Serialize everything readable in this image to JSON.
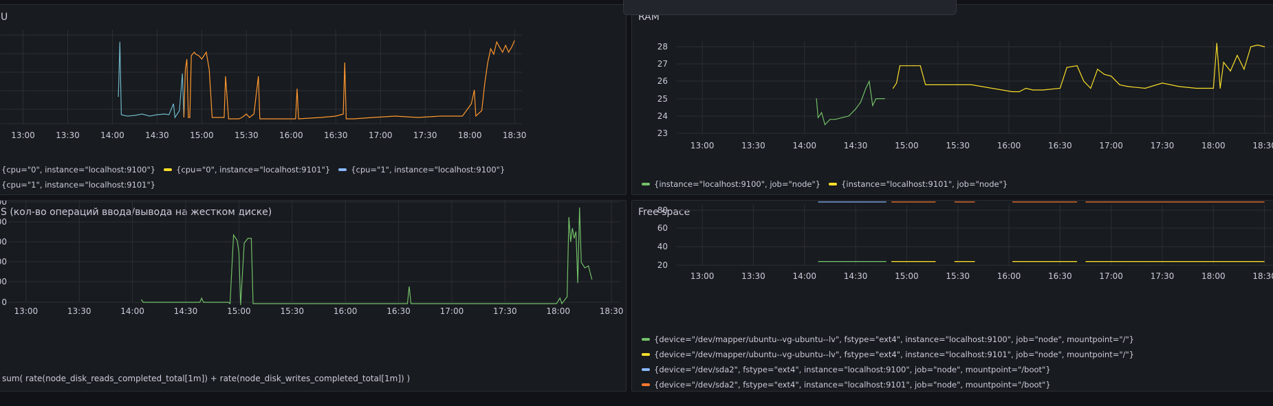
{
  "panels": {
    "cpu": {
      "title": "U",
      "x_ticks": [
        "13:00",
        "13:30",
        "14:00",
        "14:30",
        "15:00",
        "15:30",
        "16:00",
        "16:30",
        "17:00",
        "17:30",
        "18:00",
        "18:30"
      ],
      "legend": [
        [
          {
            "label": "{cpu=\"0\", instance=\"localhost:9100\"}",
            "color": ""
          },
          {
            "label": "{cpu=\"0\", instance=\"localhost:9101\"}",
            "color": "#fade2a"
          },
          {
            "label": "{cpu=\"1\", instance=\"localhost:9100\"}",
            "color": "#8ab8ff"
          }
        ],
        [
          {
            "label": "{cpu=\"1\", instance=\"localhost:9101\"}",
            "color": ""
          }
        ]
      ],
      "series_colors": [
        "#6fb7c9",
        "#ff9830"
      ]
    },
    "ram": {
      "title": "RAM",
      "y_ticks": [
        "28",
        "27",
        "26",
        "25",
        "24",
        "23"
      ],
      "x_ticks": [
        "13:00",
        "13:30",
        "14:00",
        "14:30",
        "15:00",
        "15:30",
        "16:00",
        "16:30",
        "17:00",
        "17:30",
        "18:00",
        "18:30"
      ],
      "legend": [
        {
          "label": "{instance=\"localhost:9100\", job=\"node\"}",
          "color": "#73bf69"
        },
        {
          "label": "{instance=\"localhost:9101\", job=\"node\"}",
          "color": "#fade2a"
        }
      ]
    },
    "iops": {
      "title": "S (кол-во операций ввода/вывода на жестком диске)",
      "y_ticks": [
        "00",
        "00",
        "00",
        "00",
        "00",
        "0"
      ],
      "x_ticks": [
        "13:00",
        "13:30",
        "14:00",
        "14:30",
        "15:00",
        "15:30",
        "16:00",
        "16:30",
        "17:00",
        "17:30",
        "18:00",
        "18:30"
      ],
      "query": "sum( rate(node_disk_reads_completed_total[1m]) + rate(node_disk_writes_completed_total[1m]) )",
      "series_color": "#73bf69"
    },
    "free": {
      "title": "Free space",
      "y_ticks": [
        "80",
        "60",
        "40",
        "20"
      ],
      "x_ticks": [
        "13:00",
        "13:30",
        "14:00",
        "14:30",
        "15:00",
        "15:30",
        "16:00",
        "16:30",
        "17:00",
        "17:30",
        "18:00",
        "18:30"
      ],
      "legend": [
        {
          "label": "{device=\"/dev/mapper/ubuntu--vg-ubuntu--lv\", fstype=\"ext4\", instance=\"localhost:9100\", job=\"node\", mountpoint=\"/\"}",
          "color": "#73bf69"
        },
        {
          "label": "{device=\"/dev/mapper/ubuntu--vg-ubuntu--lv\", fstype=\"ext4\", instance=\"localhost:9101\", job=\"node\", mountpoint=\"/\"}",
          "color": "#fade2a"
        },
        {
          "label": "{device=\"/dev/sda2\", fstype=\"ext4\", instance=\"localhost:9100\", job=\"node\", mountpoint=\"/boot\"}",
          "color": "#8ab8ff"
        },
        {
          "label": "{device=\"/dev/sda2\", fstype=\"ext4\", instance=\"localhost:9101\", job=\"node\", mountpoint=\"/boot\"}",
          "color": "#ff7830"
        }
      ]
    }
  },
  "chart_data": [
    {
      "type": "line",
      "title": "RAM",
      "ylim": [
        23,
        28.5
      ],
      "x_range": [
        "12:45",
        "18:35"
      ],
      "series": [
        {
          "name": "{instance=\"localhost:9100\", job=\"node\"}",
          "x": [
            "14:07",
            "14:08",
            "14:10",
            "14:12",
            "14:15",
            "14:18",
            "14:22",
            "14:26",
            "14:30",
            "14:33",
            "14:36",
            "14:38",
            "14:40",
            "14:42",
            "14:44",
            "14:47"
          ],
          "values": [
            25.0,
            23.9,
            24.2,
            23.5,
            23.8,
            23.8,
            23.9,
            24.0,
            24.4,
            24.8,
            25.6,
            26.0,
            24.6,
            25.0,
            25.0,
            25.0
          ]
        },
        {
          "name": "{instance=\"localhost:9101\", job=\"node\"}",
          "x": [
            "14:52",
            "14:54",
            "14:56",
            "15:00",
            "15:04",
            "15:08",
            "15:11",
            "15:15",
            "15:25",
            "15:30",
            "15:38",
            "16:02",
            "16:06",
            "16:10",
            "16:14",
            "16:20",
            "16:30",
            "16:34",
            "16:40",
            "16:44",
            "16:48",
            "16:52",
            "16:56",
            "17:00",
            "17:05",
            "17:10",
            "17:20",
            "17:30",
            "17:40",
            "17:50",
            "18:00",
            "18:02",
            "18:04",
            "18:06",
            "18:10",
            "18:14",
            "18:18",
            "18:22",
            "18:26",
            "18:30"
          ],
          "values": [
            25.6,
            25.9,
            26.9,
            26.9,
            26.9,
            26.9,
            25.8,
            25.8,
            25.8,
            25.8,
            25.8,
            25.4,
            25.4,
            25.6,
            25.5,
            25.5,
            25.6,
            26.8,
            26.9,
            26.0,
            25.6,
            26.7,
            26.4,
            26.3,
            25.8,
            25.7,
            25.6,
            25.9,
            25.7,
            25.6,
            25.6,
            28.2,
            25.6,
            27.1,
            26.6,
            27.5,
            26.7,
            28.0,
            28.1,
            28.0
          ]
        }
      ]
    },
    {
      "type": "line",
      "title": "Free space",
      "ylim": [
        15,
        92
      ],
      "x_range": [
        "12:45",
        "18:35"
      ],
      "series": [
        {
          "name": "{device=\"/dev/mapper/ubuntu--vg-ubuntu--lv\", fstype=\"ext4\", instance=\"localhost:9100\", job=\"node\", mountpoint=\"/\"}",
          "x": [
            "14:08",
            "14:48"
          ],
          "values": [
            24,
            24
          ]
        },
        {
          "name": "{device=\"/dev/mapper/ubuntu--vg-ubuntu--lv\", fstype=\"ext4\", instance=\"localhost:9101\", job=\"node\", mountpoint=\"/\"}",
          "x": [
            "14:51",
            "15:17",
            "15:28",
            "15:40",
            "16:02",
            "16:40",
            "16:45",
            "18:30"
          ],
          "values": [
            24,
            24,
            24,
            24,
            24,
            24,
            24,
            24
          ]
        },
        {
          "name": "{device=\"/dev/sda2\", fstype=\"ext4\", instance=\"localhost:9100\", job=\"node\", mountpoint=\"/boot\"}",
          "x": [
            "14:08",
            "14:48"
          ],
          "values": [
            89,
            89
          ]
        },
        {
          "name": "{device=\"/dev/sda2\", fstype=\"ext4\", instance=\"localhost:9101\", job=\"node\", mountpoint=\"/boot\"}",
          "x": [
            "14:51",
            "15:17",
            "15:28",
            "15:40",
            "16:02",
            "16:40",
            "16:45",
            "18:30"
          ],
          "values": [
            89,
            89,
            89,
            89,
            89,
            89,
            89,
            89
          ]
        }
      ]
    }
  ]
}
